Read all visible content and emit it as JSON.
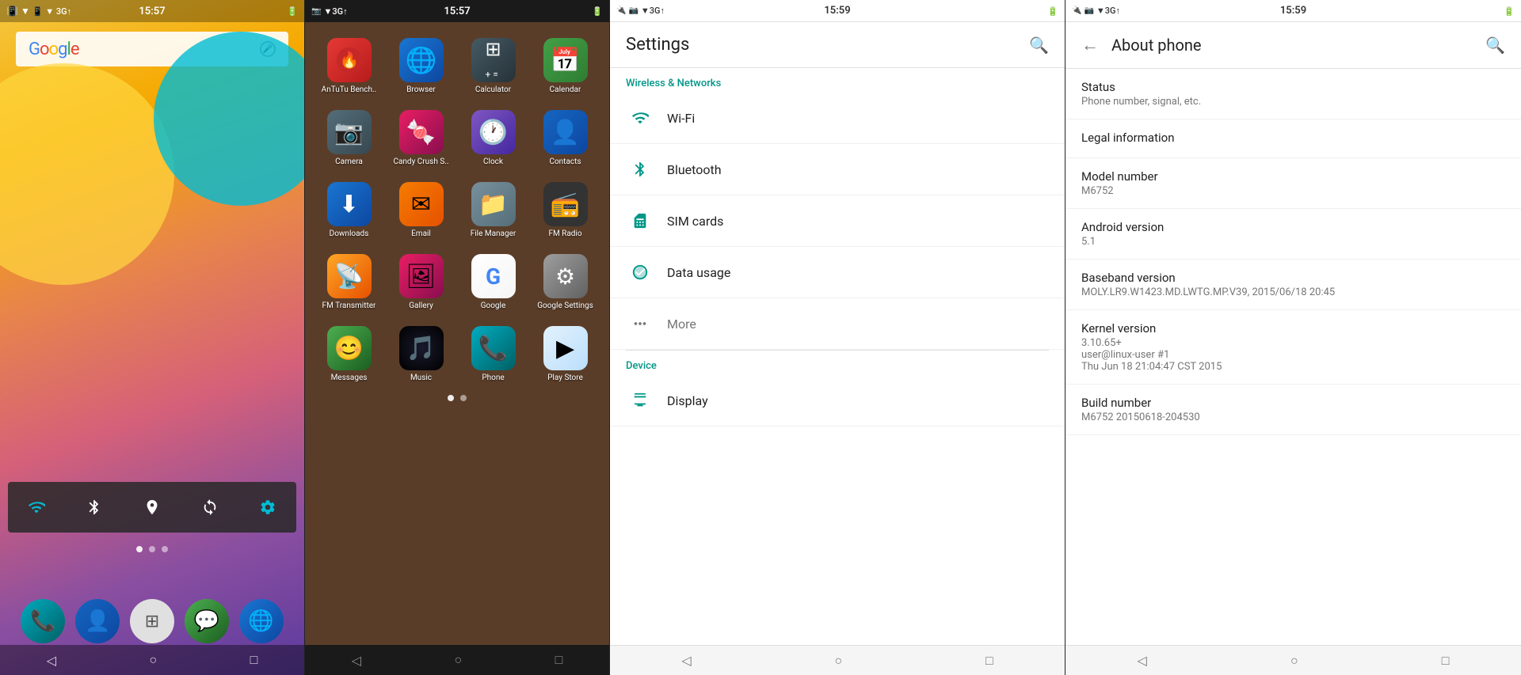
{
  "phones": [
    {
      "id": "home",
      "status_bar": {
        "left_icons": "📱 ▼ 3G↑",
        "time": "15:57",
        "battery": "🔋"
      },
      "google_bar": {
        "text": "Google",
        "mic_label": "🎤"
      },
      "quick_settings": {
        "icons": [
          "wifi",
          "bluetooth",
          "location",
          "sync",
          "settings"
        ]
      },
      "dock": {
        "apps": [
          {
            "name": "Phone",
            "label": "Phone"
          },
          {
            "name": "Contacts",
            "label": "Contacts"
          },
          {
            "name": "Launcher",
            "label": "Launcher"
          },
          {
            "name": "Messages",
            "label": "Messages"
          },
          {
            "name": "Browser",
            "label": "Browser"
          }
        ]
      },
      "nav": [
        "◁",
        "○",
        "□"
      ]
    },
    {
      "id": "app-drawer",
      "status_bar": {
        "time": "15:57"
      },
      "apps": [
        {
          "name": "AnTuTu Bench..",
          "icon_class": "icon-antutu",
          "symbol": "🔥"
        },
        {
          "name": "Browser",
          "icon_class": "icon-browser",
          "symbol": "🌐"
        },
        {
          "name": "Calculator",
          "icon_class": "icon-calculator",
          "symbol": "🔢"
        },
        {
          "name": "Calendar",
          "icon_class": "icon-calendar",
          "symbol": "📅"
        },
        {
          "name": "Camera",
          "icon_class": "icon-camera",
          "symbol": "📷"
        },
        {
          "name": "Candy Crush S..",
          "icon_class": "icon-candy",
          "symbol": "🍬"
        },
        {
          "name": "Clock",
          "icon_class": "icon-clock",
          "symbol": "🕐"
        },
        {
          "name": "Contacts",
          "icon_class": "icon-contacts",
          "symbol": "👤"
        },
        {
          "name": "Downloads",
          "icon_class": "icon-downloads",
          "symbol": "⬇"
        },
        {
          "name": "Email",
          "icon_class": "icon-email",
          "symbol": "✉"
        },
        {
          "name": "File Manager",
          "icon_class": "icon-filemanager",
          "symbol": "📁"
        },
        {
          "name": "FM Radio",
          "icon_class": "icon-fmradio",
          "symbol": "📻"
        },
        {
          "name": "FM Transmitter",
          "icon_class": "icon-fmtransmitter",
          "symbol": "📡"
        },
        {
          "name": "Gallery",
          "icon_class": "icon-gallery",
          "symbol": "🖼"
        },
        {
          "name": "Google",
          "icon_class": "icon-google",
          "symbol": "G"
        },
        {
          "name": "Google Settings",
          "icon_class": "icon-googlesettings",
          "symbol": "⚙"
        },
        {
          "name": "Messages",
          "icon_class": "icon-messages",
          "symbol": "💬"
        },
        {
          "name": "Music",
          "icon_class": "icon-music",
          "symbol": "🎵"
        },
        {
          "name": "Phone",
          "icon_class": "icon-phone",
          "symbol": "📞"
        },
        {
          "name": "Play Store",
          "icon_class": "icon-playstore",
          "symbol": "▶"
        }
      ],
      "nav": [
        "◁",
        "○",
        "□"
      ]
    },
    {
      "id": "settings",
      "header": {
        "title": "Settings",
        "search_icon": "🔍"
      },
      "sections": [
        {
          "title": "Wireless & networks",
          "items": [
            {
              "icon": "wifi",
              "label": "Wi-Fi"
            },
            {
              "icon": "bluetooth",
              "label": "Bluetooth"
            },
            {
              "icon": "sim",
              "label": "SIM cards"
            },
            {
              "icon": "data",
              "label": "Data usage"
            },
            {
              "icon": "more",
              "label": "More"
            }
          ]
        },
        {
          "title": "Device",
          "items": [
            {
              "icon": "display",
              "label": "Display"
            }
          ]
        }
      ],
      "nav": [
        "◁",
        "○",
        "□"
      ]
    },
    {
      "id": "about-phone",
      "header": {
        "back_icon": "←",
        "title": "About phone",
        "search_icon": "🔍"
      },
      "items": [
        {
          "title": "Status",
          "subtitle": "Phone number, signal, etc."
        },
        {
          "title": "Legal information",
          "subtitle": ""
        },
        {
          "title": "Model number",
          "subtitle": "M6752"
        },
        {
          "title": "Android version",
          "subtitle": "5.1"
        },
        {
          "title": "Baseband version",
          "subtitle": "MOLY.LR9.W1423.MD.LWTG.MP.V39, 2015/06/18 20:45"
        },
        {
          "title": "Kernel version",
          "subtitle": "3.10.65+\nuser@linux-user #1\nThu Jun 18 21:04:47 CST 2015"
        },
        {
          "title": "Build number",
          "subtitle": "M6752 20150618-204530"
        }
      ],
      "nav": [
        "◁",
        "○",
        "□"
      ]
    }
  ]
}
